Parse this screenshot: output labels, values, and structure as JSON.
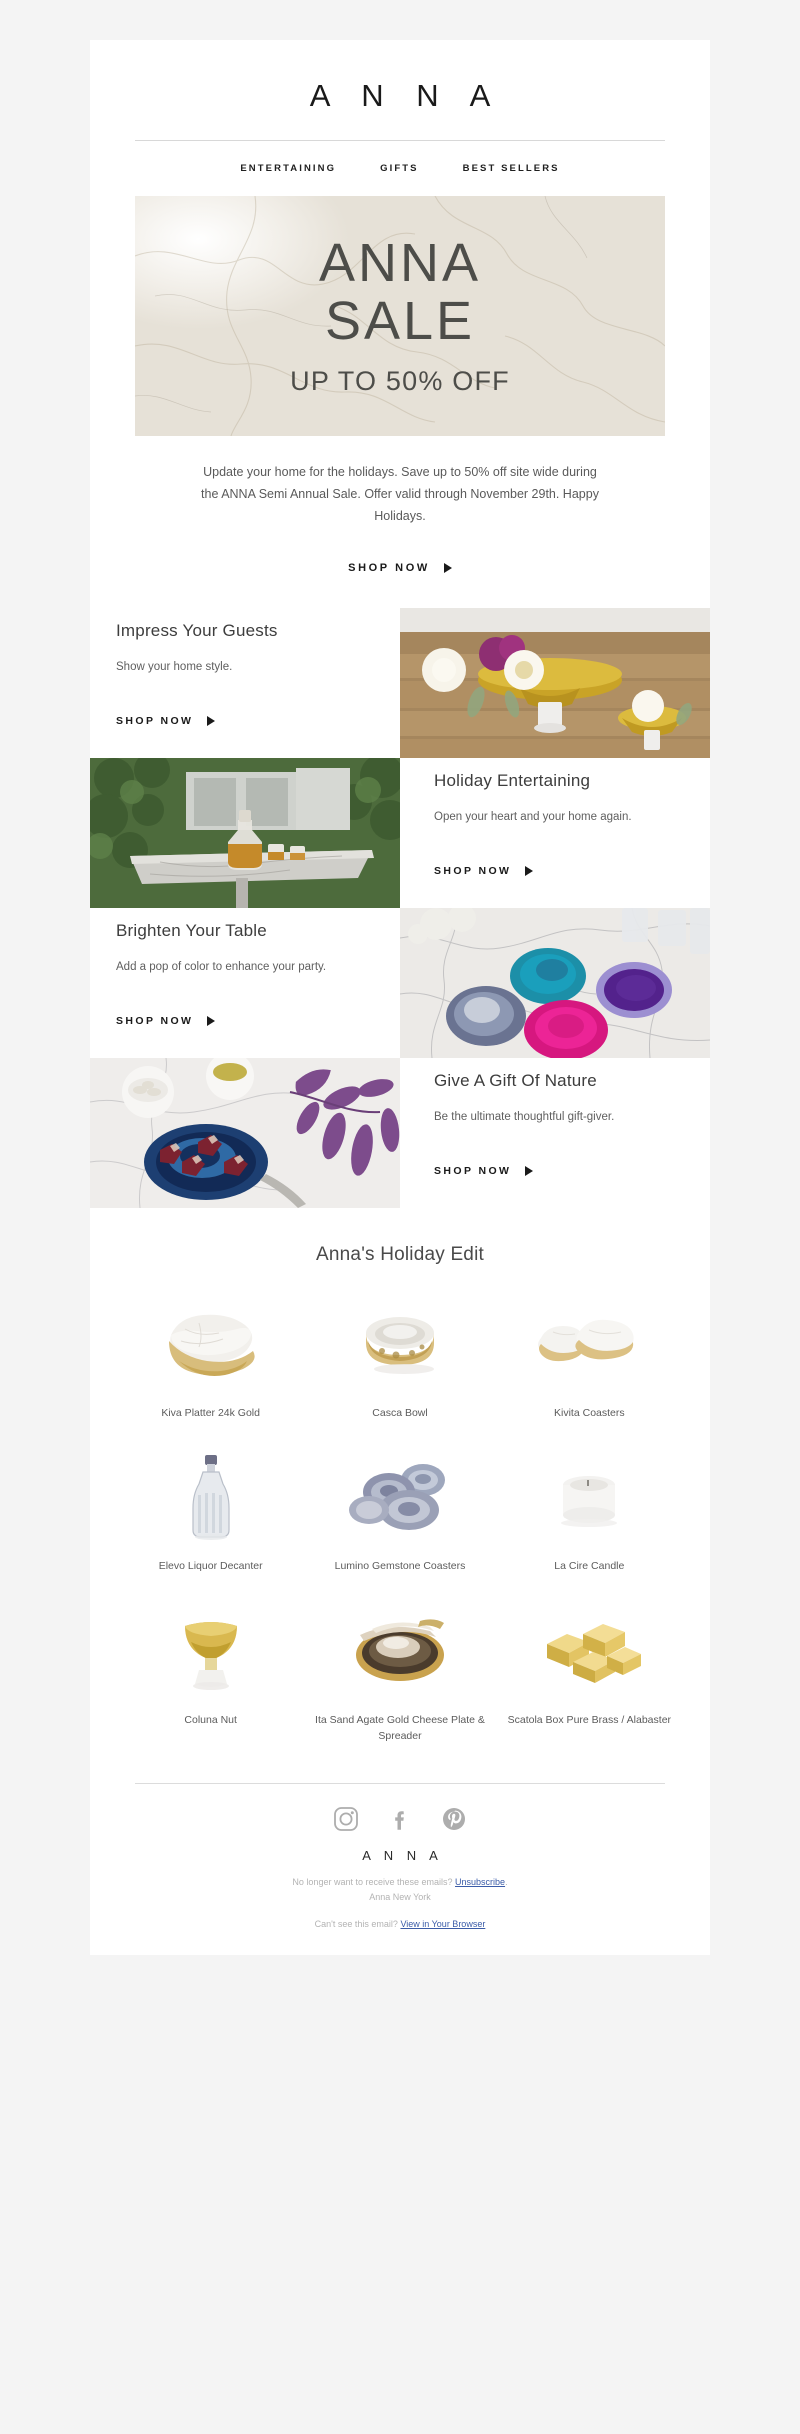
{
  "brand": {
    "logo": "A N N A",
    "footer_logo": "A N N A"
  },
  "nav": {
    "items": [
      {
        "label": "ENTERTAINING"
      },
      {
        "label": "GIFTS"
      },
      {
        "label": "BEST SELLERS"
      }
    ]
  },
  "hero": {
    "line1": "ANNA",
    "line2": "SALE",
    "subline": "UP TO 50% OFF"
  },
  "intro": {
    "body": "Update your home for the holidays. Save up to 50% off site wide during the ANNA Semi Annual Sale. Offer valid through November 29th. Happy Holidays.",
    "cta_label": "SHOP NOW"
  },
  "sections": [
    {
      "title": "Impress Your Guests",
      "desc": "Show your home style.",
      "cta_label": "SHOP NOW",
      "image_alt": "gold footed bowls with white roses on wood table",
      "image_side": "right"
    },
    {
      "title": "Holiday Entertaining",
      "desc": "Open your heart and your home again.",
      "cta_label": "SHOP NOW",
      "image_alt": "crystal decanter and glasses on marble patio table",
      "image_side": "left"
    },
    {
      "title": "Brighten Your Table",
      "desc": "Add a pop of color to enhance your party.",
      "cta_label": "SHOP NOW",
      "image_alt": "teal purple pink and blue agate coasters on marble",
      "image_side": "right"
    },
    {
      "title": "Give A Gift Of Nature",
      "desc": "Be the ultimate thoughtful gift-giver.",
      "cta_label": "SHOP NOW",
      "image_alt": "blue agate plate with chocolates and purple leaves",
      "image_side": "left"
    }
  ],
  "edit": {
    "heading": "Anna's Holiday Edit",
    "products": [
      {
        "name": "Kiva Platter 24k Gold",
        "art": "platter-gold"
      },
      {
        "name": "Casca Bowl",
        "art": "casca-bowl"
      },
      {
        "name": "Kivita Coasters",
        "art": "kivita-coasters"
      },
      {
        "name": "Elevo Liquor Decanter",
        "art": "decanter"
      },
      {
        "name": "Lumino Gemstone Coasters",
        "art": "gemstone-coasters"
      },
      {
        "name": "La Cire Candle",
        "art": "candle"
      },
      {
        "name": "Coluna Nut",
        "art": "coluna-nut"
      },
      {
        "name": "Ita Sand Agate Gold Cheese Plate & Spreader",
        "art": "cheese-plate"
      },
      {
        "name": "Scatola Box Pure Brass / Alabaster",
        "art": "scatola-box"
      }
    ]
  },
  "footer": {
    "social": [
      {
        "icon": "instagram-icon",
        "name": "Instagram"
      },
      {
        "icon": "facebook-icon",
        "name": "Facebook"
      },
      {
        "icon": "pinterest-icon",
        "name": "Pinterest"
      }
    ],
    "unsub_prefix": "No longer want to receive these emails?",
    "unsub_link": "Unsubscribe",
    "unsub_suffix": ".",
    "address": "Anna New York",
    "browser_prefix": "Can't see this email?",
    "browser_link": "View in Your Browser"
  },
  "colors": {
    "page_bg": "#f4f4f4",
    "body_bg": "#ffffff",
    "text_dark": "#1a1a1a",
    "text_body": "#5a5a5a",
    "hero_text": "#4d4d49",
    "link": "#3b5ca8",
    "muted": "#b3b3b3"
  }
}
